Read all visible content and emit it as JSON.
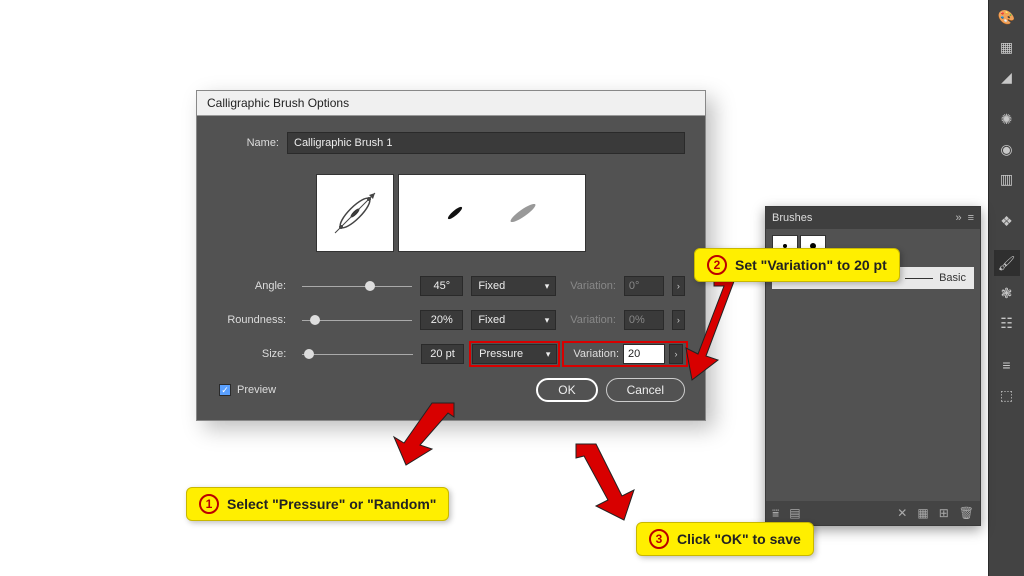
{
  "dialog": {
    "title": "Calligraphic Brush Options",
    "name_label": "Name:",
    "name_value": "Calligraphic Brush 1",
    "angle": {
      "label": "Angle:",
      "value": "45°",
      "mode": "Fixed",
      "var_label": "Variation:",
      "var_value": "0°",
      "slider_pct": 62
    },
    "roundness": {
      "label": "Roundness:",
      "value": "20%",
      "mode": "Fixed",
      "var_label": "Variation:",
      "var_value": "0%",
      "slider_pct": 12
    },
    "size": {
      "label": "Size:",
      "value": "20 pt",
      "mode": "Pressure",
      "var_label": "Variation:",
      "var_value": "20",
      "slider_pct": 6
    },
    "preview_label": "Preview",
    "ok_label": "OK",
    "cancel_label": "Cancel"
  },
  "brushes_panel": {
    "title": "Brushes",
    "basic_label": "Basic"
  },
  "callouts": {
    "c1": {
      "num": "1",
      "text": "Select \"Pressure\" or \"Random\""
    },
    "c2": {
      "num": "2",
      "text": "Set \"Variation\" to 20 pt"
    },
    "c3": {
      "num": "3",
      "text": "Click \"OK\" to save"
    }
  }
}
